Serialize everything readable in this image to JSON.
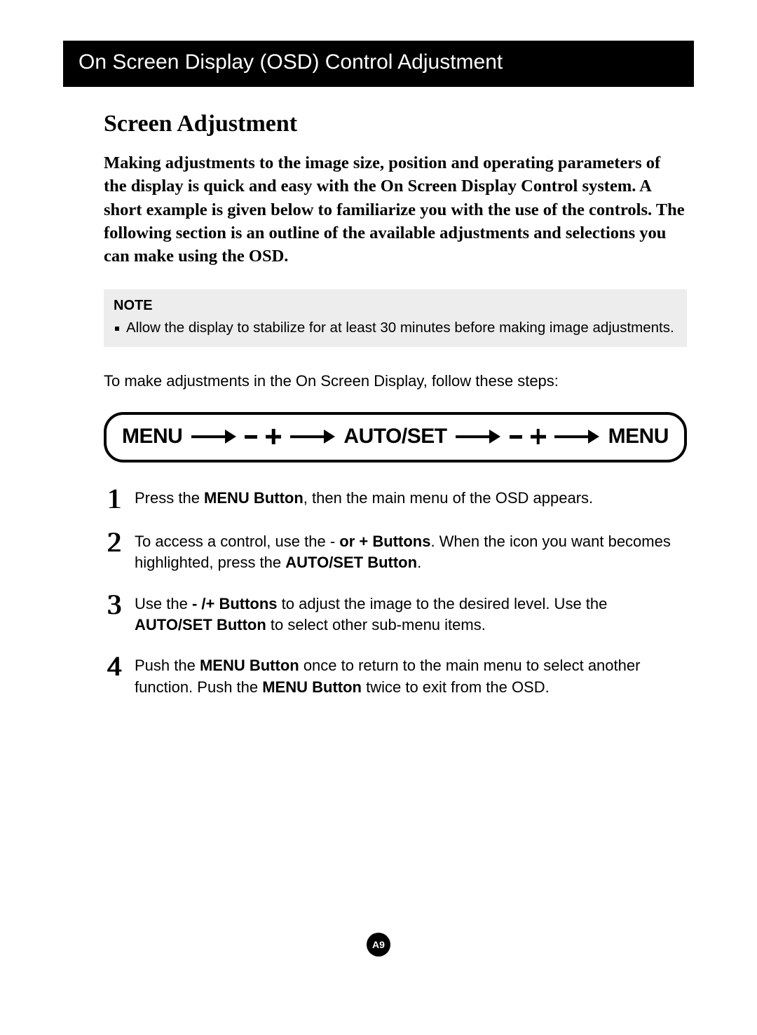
{
  "header": "On Screen Display (OSD) Control Adjustment",
  "section_heading": "Screen Adjustment",
  "intro": "Making adjustments to the image size, position and operating parameters of the display is quick and easy with the On Screen Display Control system. A short example is given below to familiarize you with the use of the controls. The following section is an outline of the available adjustments and selections you can make using the OSD.",
  "note": {
    "title": "NOTE",
    "items": [
      "Allow the display to stabilize for at least 30 minutes before making image adjustments."
    ]
  },
  "lead": "To make adjustments in the On Screen Display, follow these steps:",
  "flow": {
    "t1": "MENU",
    "t2": "AUTO/SET",
    "t3": "MENU"
  },
  "steps": [
    {
      "num": "1",
      "pre": "Press the ",
      "b1": "MENU Button",
      "post": ", then the main menu of the OSD appears."
    },
    {
      "num": "2",
      "pre": "To access a control, use the - ",
      "b1": "or + Buttons",
      "mid": ". When the icon you want becomes highlighted, press the ",
      "b2": "AUTO/SET Button",
      "post": "."
    },
    {
      "num": "3",
      "pre": " Use the  ",
      "b1": "- /+ Buttons",
      "mid": " to adjust the image to the desired level. Use the ",
      "b2": "AUTO/SET Button",
      "post": " to select other sub-menu items."
    },
    {
      "num": "4",
      "pre": "Push the ",
      "b1": "MENU Button",
      "mid": " once to return to the main menu to select another function. Push the ",
      "b2": "MENU Button",
      "post": " twice to exit from the OSD."
    }
  ],
  "page_number": "A9"
}
